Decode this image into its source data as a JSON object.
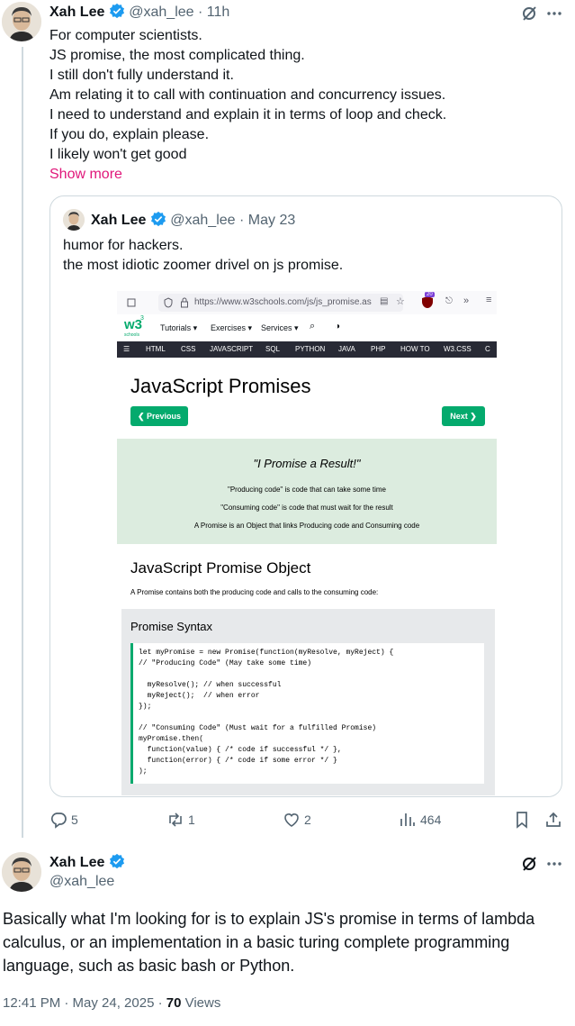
{
  "colors": {
    "accent": "#1d9bf0",
    "show_more": "#e0177a",
    "w3_green": "#04aa6d"
  },
  "tweet1": {
    "name": "Xah Lee",
    "handle": "@xah_lee",
    "time": "· 11h",
    "lines": [
      "For computer scientists.",
      "JS promise, the most complicated thing.",
      "I still don't fully understand it.",
      "Am relating it to call with continuation and concurrency issues.",
      "I need to understand and explain it in terms of loop and check.",
      "If you do, explain please.",
      "I likely won't get good"
    ],
    "show_more": "Show more"
  },
  "quote": {
    "name": "Xah Lee",
    "handle": "@xah_lee",
    "date": "· May 23",
    "lines": [
      "humor for hackers.",
      "the most idiotic zoomer drivel on js promise."
    ]
  },
  "screenshot": {
    "url": "https://www.w3schools.com/js/js_promise.as",
    "badge": "20",
    "w3_logo": "w3",
    "w3_sup": "3",
    "w3_small": "schools",
    "menu": [
      "Tutorials ▾",
      "Exercises ▾",
      "Services ▾"
    ],
    "dark_nav": [
      "☰",
      "HTML",
      "CSS",
      "JAVASCRIPT",
      "SQL",
      "PYTHON",
      "JAVA",
      "PHP",
      "HOW TO",
      "W3.CSS",
      "C"
    ],
    "title": "JavaScript Promises",
    "prev": "❮ Previous",
    "next": "Next ❯",
    "promise_quote": "\"I Promise a Result!\"",
    "promise_lines": [
      "\"Producing code\" is code that can take some time",
      "\"Consuming code\" is code that must wait for the result",
      "A Promise is an Object that links Producing code and Consuming code"
    ],
    "object_title": "JavaScript Promise Object",
    "object_desc": "A Promise contains both the producing code and calls to the consuming code:",
    "syntax_title": "Promise Syntax",
    "code": "let myPromise = new Promise(function(myResolve, myReject) {\n// \"Producing Code\" (May take some time)\n\n  myResolve(); // when successful\n  myReject();  // when error\n});\n\n// \"Consuming Code\" (Must wait for a fulfilled Promise)\nmyPromise.then(\n  function(value) { /* code if successful */ },\n  function(error) { /* code if some error */ }\n);"
  },
  "actions": {
    "replies": "5",
    "reposts": "1",
    "likes": "2",
    "views": "464"
  },
  "tweet2": {
    "name": "Xah Lee",
    "handle": "@xah_lee",
    "text": "Basically what I'm looking for is to explain JS's promise in terms of lambda calculus, or an implementation in a basic turing complete programming language, such as basic bash or Python.",
    "timestamp": "12:41 PM · May 24, 2025 · ",
    "views_count": "70",
    "views_label": " Views"
  },
  "icons": [
    "grok-icon",
    "more-icon",
    "verified-icon",
    "reply-icon",
    "repost-icon",
    "like-icon",
    "views-icon",
    "bookmark-icon",
    "share-icon"
  ]
}
